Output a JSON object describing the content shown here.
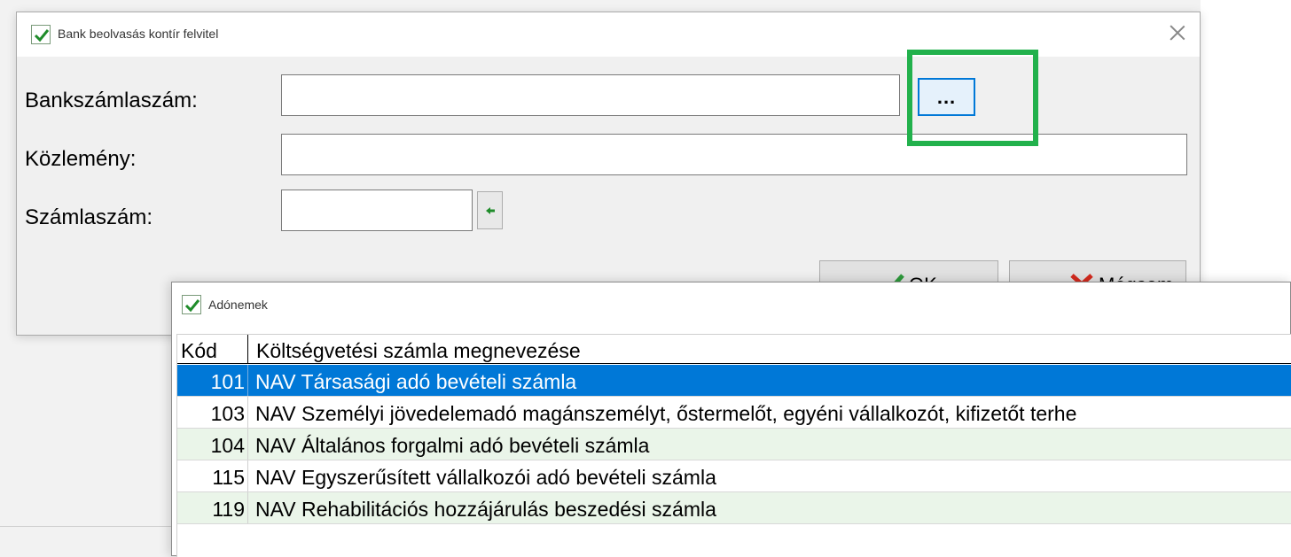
{
  "main_dialog": {
    "title": "Bank beolvasás kontír felvitel",
    "labels": {
      "bankszamlaszam": "Bankszámlaszám:",
      "kozlemeny": "Közlemény:",
      "szamlaszam": "Számlaszám:"
    },
    "fields": {
      "bankszamlaszam_value": "",
      "kozlemeny_value": "",
      "szamlaszam_value": ""
    },
    "ellipsis_label": "...",
    "buttons": {
      "ok_label": "OK",
      "cancel_label": "Mégsem"
    }
  },
  "ado_dialog": {
    "title": "Adónemek",
    "columns": {
      "code": "Kód",
      "name": "Költségvetési számla megnevezése"
    },
    "rows": [
      {
        "code": "101",
        "name": "NAV Társasági adó bevételi számla"
      },
      {
        "code": "103",
        "name": "NAV Személyi jövedelemadó magánszemélyt, őstermelőt, egyéni vállalkozót, kifizetőt terhe"
      },
      {
        "code": "104",
        "name": "NAV Általános forgalmi adó bevételi számla"
      },
      {
        "code": "115",
        "name": "NAV Egyszerűsített vállalkozói adó bevételi számla"
      },
      {
        "code": "119",
        "name": "NAV Rehabilitációs hozzájárulás beszedési számla"
      }
    ],
    "selected_row_index": 0
  },
  "colors": {
    "highlight_green": "#22b14c",
    "selection_blue": "#0078d7",
    "row_alt_green": "#eaf5e9",
    "ok_check_green": "#2e9a3c",
    "cancel_x_red": "#d42a1e"
  },
  "icons": {
    "app": "checkmark-icon",
    "close": "close-icon",
    "arrow": "arrow-left-icon",
    "ok": "ok-check-icon",
    "cancel": "cancel-x-icon"
  }
}
